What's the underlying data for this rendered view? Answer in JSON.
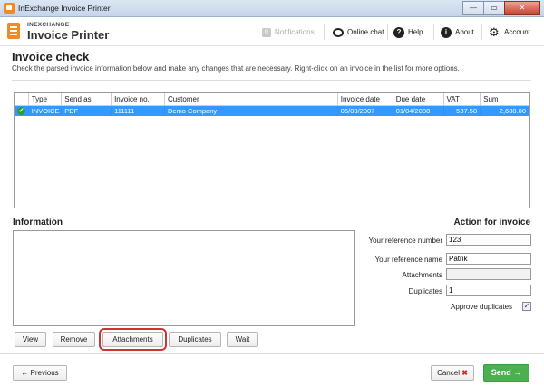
{
  "window": {
    "title": "InExchange Invoice Printer",
    "minimize": "—",
    "maximize": "▭",
    "close": "✕"
  },
  "header": {
    "brand_small": "INEXCHANGE",
    "brand_big": "Invoice Printer",
    "notifications_count": "0",
    "notifications_label": "Notifications",
    "chat_label": "Online chat",
    "help_label": "Help",
    "about_label": "About",
    "account_label": "Account"
  },
  "page": {
    "title": "Invoice check",
    "description": "Check the parsed invoice information below and make any changes that are necessary. Right-click on an invoice in the list for more options."
  },
  "grid": {
    "columns": [
      "",
      "Type",
      "Send as",
      "Invoice no.",
      "Customer",
      "Invoice date",
      "Due date",
      "VAT",
      "Sum"
    ],
    "rows": [
      {
        "status": "✔",
        "type": "INVOICE",
        "send_as": "PDF",
        "invoice_no": "111111",
        "customer": "Demo Company",
        "invoice_date": "05/03/2007",
        "due_date": "01/04/2008",
        "vat": "537.50",
        "sum": "2,688.00"
      }
    ]
  },
  "information": {
    "title": "Information"
  },
  "action": {
    "title": "Action for invoice",
    "your_reference_number_label": "Your reference number",
    "your_reference_number": "123",
    "your_reference_name_label": "Your reference name",
    "your_reference_name": "Patrik",
    "attachments_label": "Attachments",
    "attachments": "",
    "duplicates_label": "Duplicates",
    "duplicates": "1",
    "approve_duplicates_label": "Approve duplicates",
    "approve_duplicates_mark": "✓"
  },
  "buttons": {
    "view": "View",
    "remove": "Remove",
    "attachments": "Attachments",
    "duplicates": "Duplicates",
    "wait": "Wait",
    "previous": "← Previous",
    "cancel": "Cancel",
    "cancel_icon": "✖",
    "send": "Send →"
  }
}
